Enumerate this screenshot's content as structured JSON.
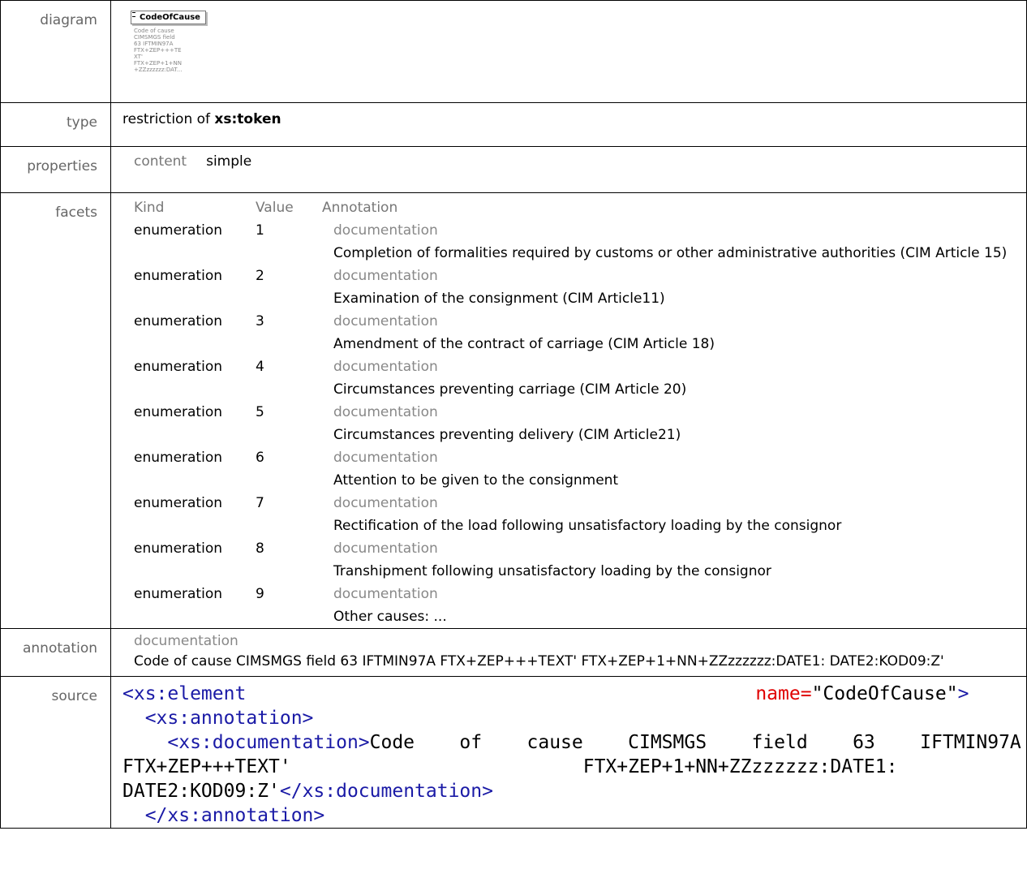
{
  "labels": {
    "diagram": "diagram",
    "type": "type",
    "properties": "properties",
    "facets": "facets",
    "annotation": "annotation",
    "source": "source"
  },
  "diagram": {
    "box_title": "CodeOfCause",
    "note": "Code of cause\nCIMSMGS field\n63 IFTMIN97A\nFTX+ZEP+++TE\nXT'\nFTX+ZEP+1+NN\n+ZZzzzzzz:DAT..."
  },
  "type": {
    "prefix": "restriction of ",
    "base": "xs:token"
  },
  "properties": {
    "key": "content",
    "value": "simple"
  },
  "facets": {
    "headers": [
      "Kind",
      "Value",
      "Annotation"
    ],
    "doc_label": "documentation",
    "rows": [
      {
        "kind": "enumeration",
        "value": "1",
        "text": "Completion of formalities required by customs or other administrative authorities (CIM Article 15)"
      },
      {
        "kind": "enumeration",
        "value": "2",
        "text": "Examination of the consignment (CIM Article11)"
      },
      {
        "kind": "enumeration",
        "value": "3",
        "text": "Amendment of the contract of carriage (CIM Article 18)"
      },
      {
        "kind": "enumeration",
        "value": "4",
        "text": "Circumstances preventing carriage (CIM Article 20)"
      },
      {
        "kind": "enumeration",
        "value": "5",
        "text": "Circumstances preventing delivery (CIM Article21)"
      },
      {
        "kind": "enumeration",
        "value": "6",
        "text": "Attention to be given to the consignment"
      },
      {
        "kind": "enumeration",
        "value": "7",
        "text": "Rectification of the load following unsatisfactory loading by the consignor"
      },
      {
        "kind": "enumeration",
        "value": "8",
        "text": "Transhipment following unsatisfactory loading by the consignor"
      },
      {
        "kind": "enumeration",
        "value": "9",
        "text": "Other causes: ..."
      }
    ]
  },
  "annotation": {
    "label": "documentation",
    "text": "Code of cause CIMSMGS field 63 IFTMIN97A FTX+ZEP+++TEXT' FTX+ZEP+1+NN+ZZzzzzzz:DATE1: DATE2:KOD09:Z'"
  },
  "source": {
    "l1_tag": "<xs:element",
    "l1_attr": "name=",
    "l1_val": "\"CodeOfCause\"",
    "l1_close": ">",
    "l2": "  <xs:annotation>",
    "l3_tag": "    <xs:documentation>",
    "l3_text": "Code    of    cause    CIMSMGS    field    63    IFTMIN97A",
    "l4": "FTX+ZEP+++TEXT'                          FTX+ZEP+1+NN+ZZzzzzzz:DATE1:",
    "l5_text": "DATE2:KOD09:Z'",
    "l5_tag": "</xs:documentation>",
    "l6": "  </xs:annotation>"
  }
}
